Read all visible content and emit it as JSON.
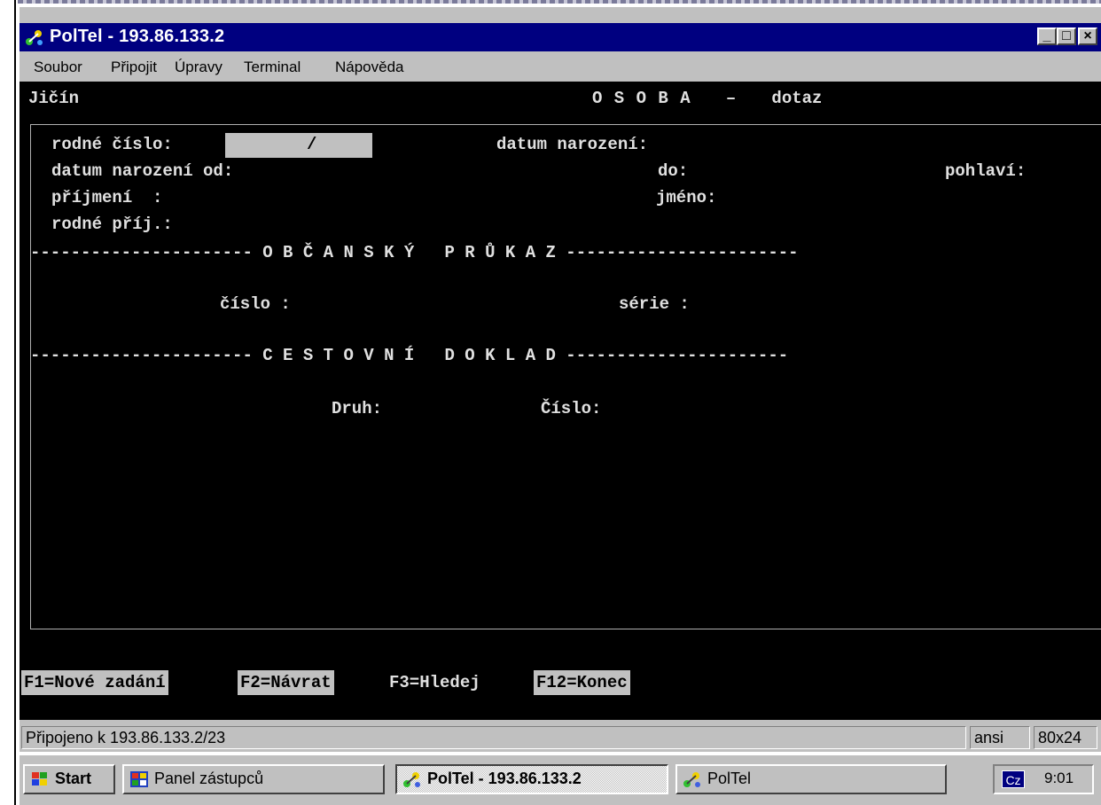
{
  "window": {
    "title": "PolTel - 193.86.133.2",
    "buttons": {
      "minimize": "_",
      "maximize": "□",
      "close": "×"
    }
  },
  "menu": [
    "Soubor",
    "Připojit",
    "Úpravy",
    "Terminal",
    "Nápověda"
  ],
  "terminal": {
    "header_left": "Jičín",
    "header_center": "O S O B A   –   dotaz",
    "fields": {
      "rodne_cislo": "rodné číslo:",
      "rodne_cislo_value": "/",
      "datum_narozeni": "datum narození:",
      "datum_narozeni_od": "datum narození od:",
      "do": "do:",
      "pohlavi": "pohlaví:",
      "prijmeni": "příjmení  :",
      "jmeno": "jméno:",
      "rodne_prij": "rodné příj.:"
    },
    "section_op": "---------------------- O B Č A N S K Ý   P R Ů K A Z -----------------------",
    "op_fields": {
      "cislo": "číslo :",
      "serie": "série :"
    },
    "section_cd": "---------------------- C E S T O V N Í   D O K L A D ----------------------",
    "cd_fields": {
      "druh": "Druh:",
      "cislo": "Číslo:"
    },
    "function_keys": [
      "F1=Nové zadání",
      "F2=Návrat",
      "F3=Hledej",
      "F12=Konec"
    ]
  },
  "status": {
    "connection": "Připojeno k 193.86.133.2/23",
    "emulation": "ansi",
    "size": "80x24"
  },
  "taskbar": {
    "start": "Start",
    "items": [
      "Panel zástupců",
      "PolTel - 193.86.133.2",
      "PolTel"
    ],
    "language": "Cz",
    "clock": "9:01"
  }
}
